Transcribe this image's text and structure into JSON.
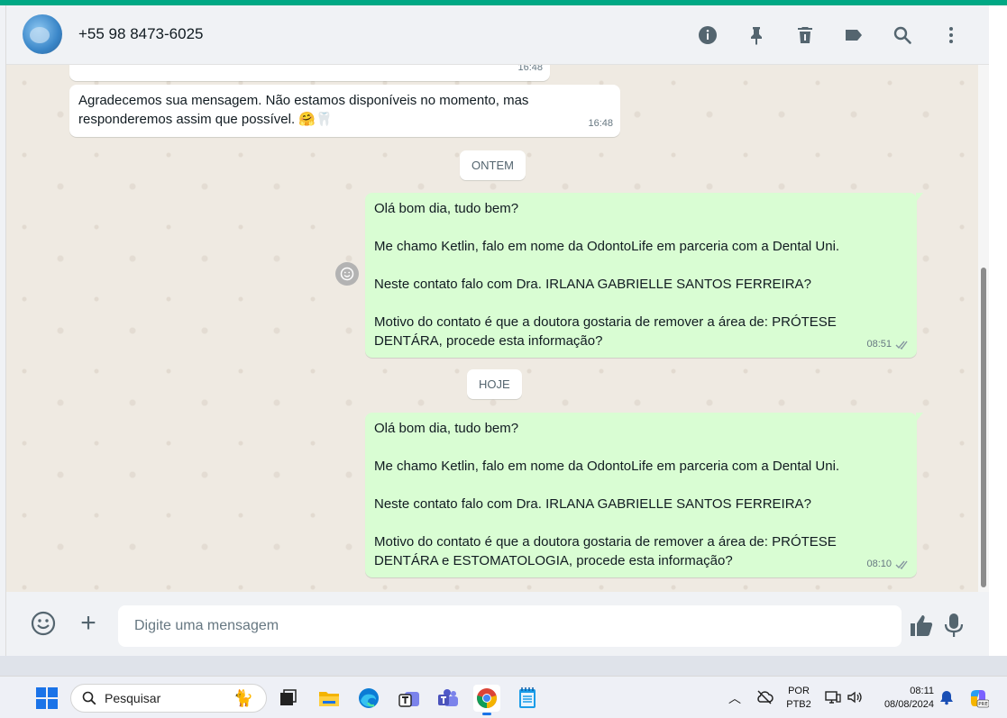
{
  "header": {
    "contact": "+55 98 8473-6025",
    "icons": [
      "info-icon",
      "pin-icon",
      "delete-icon",
      "label-icon",
      "search-icon",
      "menu-icon"
    ]
  },
  "messages": [
    {
      "direction": "in",
      "text": "",
      "time": "16:48",
      "partial": true
    },
    {
      "direction": "in",
      "text": "Agradecemos sua mensagem. Não estamos disponíveis no momento, mas\nresponderemos assim que possível. 🤗🦷",
      "time": "16:48"
    },
    {
      "direction": "out",
      "text": "Olá bom dia, tudo bem?\n\nMe chamo Ketlin, falo em nome da OdontoLife em parceria com a Dental Uni.\n\nNeste contato falo com Dra. IRLANA GABRIELLE SANTOS FERREIRA?\n\nMotivo do contato é que a doutora gostaria de remover a área de: PRÓTESE\nDENTÁRA, procede esta informação?",
      "time": "08:51"
    },
    {
      "direction": "out",
      "text": "Olá bom dia, tudo bem?\n\nMe chamo Ketlin, falo em nome da OdontoLife em parceria com a Dental Uni.\n\nNeste contato falo com Dra. IRLANA GABRIELLE SANTOS FERREIRA?\n\nMotivo do contato é que a doutora gostaria de remover a área de: PRÓTESE\nDENTÁRA e ESTOMATOLOGIA, procede esta informação?",
      "time": "08:10"
    }
  ],
  "dates": {
    "yesterday": "ONTEM",
    "today": "HOJE"
  },
  "composer": {
    "placeholder": "Digite uma mensagem"
  },
  "taskbar": {
    "search_label": "Pesquisar",
    "apps": [
      "task-view",
      "file-explorer",
      "edge",
      "teams-work",
      "teams",
      "chrome",
      "notepad"
    ],
    "lang_top": "POR",
    "lang_bottom": "PTB2",
    "time": "08:11",
    "date": "08/08/2024"
  },
  "colors": {
    "accent": "#00a884",
    "outgoing_bubble": "#d9fdd3",
    "chat_bg": "#efeae2"
  }
}
